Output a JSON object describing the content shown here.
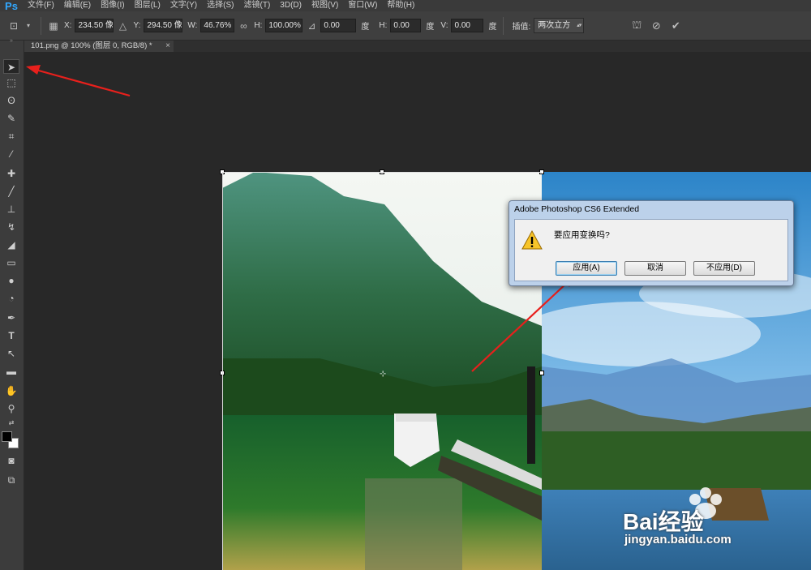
{
  "app": {
    "logo": "Ps"
  },
  "menu": [
    "文件(F)",
    "编辑(E)",
    "图像(I)",
    "图层(L)",
    "文字(Y)",
    "选择(S)",
    "滤镜(T)",
    "3D(D)",
    "视图(V)",
    "窗口(W)",
    "帮助(H)"
  ],
  "options": {
    "x_label": "X:",
    "x_value": "234.50 像",
    "y_label": "Y:",
    "y_value": "294.50 像",
    "w_label": "W:",
    "w_value": "46.76%",
    "h_label": "H:",
    "h_value": "100.00%",
    "angle_value": "0.00",
    "angle_unit": "度",
    "hskew_label": "H:",
    "hskew_value": "0.00",
    "hskew_unit": "度",
    "vskew_label": "V:",
    "vskew_value": "0.00",
    "vskew_unit": "度",
    "interp_label": "插值:",
    "interp_value": "两次立方"
  },
  "tab": {
    "title": "101.png @ 100% (图层 0, RGB/8) *",
    "close": "×"
  },
  "dialog": {
    "title": "Adobe Photoshop CS6 Extended",
    "message": "要应用变换吗?",
    "apply": "应用(A)",
    "cancel": "取消",
    "dont_apply": "不应用(D)"
  },
  "watermark": {
    "brand": "Bai经验",
    "url": "jingyan.baidu.com"
  },
  "colors": {
    "accent_arrow": "#e8201c",
    "ps_blue": "#31a8ff",
    "dialog_frame": "#bcd1ea"
  }
}
